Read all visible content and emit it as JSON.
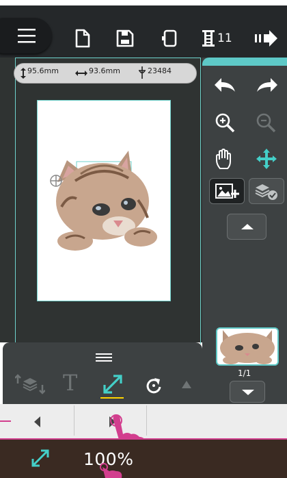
{
  "toolbar": {
    "counter": "11",
    "icons": [
      "menu-icon",
      "new-file-icon",
      "save-icon",
      "hoop-select-icon",
      "stitch-count-icon",
      "transfer-icon"
    ]
  },
  "info_bar": {
    "height": "95.6mm",
    "width": "93.6mm",
    "stitches": "23484"
  },
  "side_panel": {
    "page_indicator": "1/1",
    "icons": [
      "undo-icon",
      "redo-icon",
      "zoom-in-icon",
      "zoom-out-icon",
      "hand-pan-icon",
      "move-icon",
      "add-image-icon",
      "layer-check-icon"
    ]
  },
  "bottom": {
    "zoom_value": "100%"
  },
  "colors": {
    "accent_teal": "#44cfc8",
    "frame_teal": "#6fd3cd",
    "annotation_pink": "#d23e8e",
    "underline_yellow": "#ffd400"
  }
}
